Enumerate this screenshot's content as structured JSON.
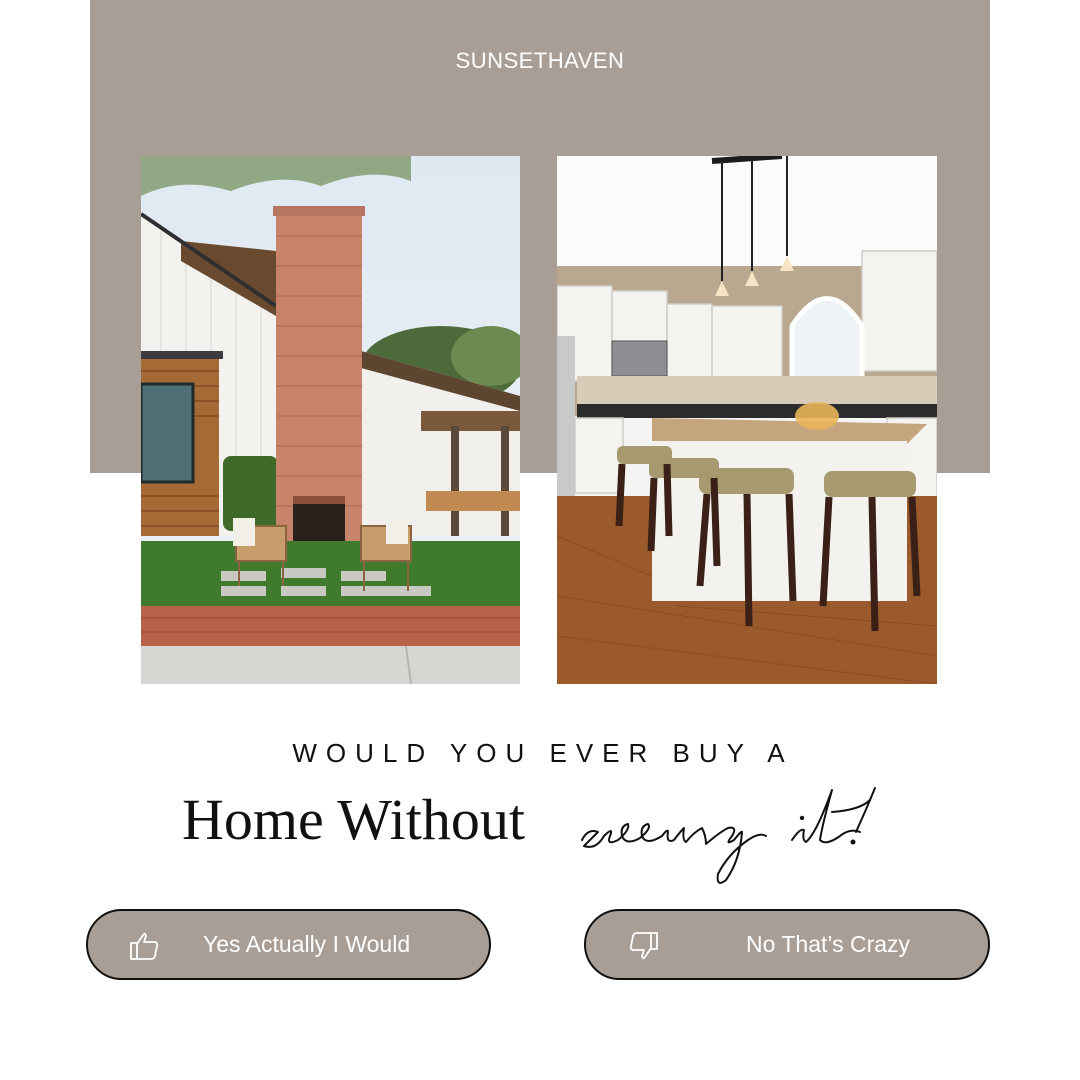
{
  "brand": {
    "name": "SUNSETHAVEN"
  },
  "photos": {
    "left": {
      "subject": "house-exterior-with-brick-fireplace-patio"
    },
    "right": {
      "subject": "white-kitchen-with-island-and-bar-stools"
    }
  },
  "question": {
    "line1": "WOULD YOU EVER BUY A",
    "headline": "Home Without",
    "script": "seeing it!"
  },
  "buttons": {
    "yes": {
      "label": "Yes Actually I Would",
      "icon": "thumbs-up-icon"
    },
    "no": {
      "label": "No That’s Crazy",
      "icon": "thumbs-down-icon"
    }
  },
  "colors": {
    "panel": "#a89e96",
    "text": "#111111",
    "button_text": "#ffffff"
  }
}
